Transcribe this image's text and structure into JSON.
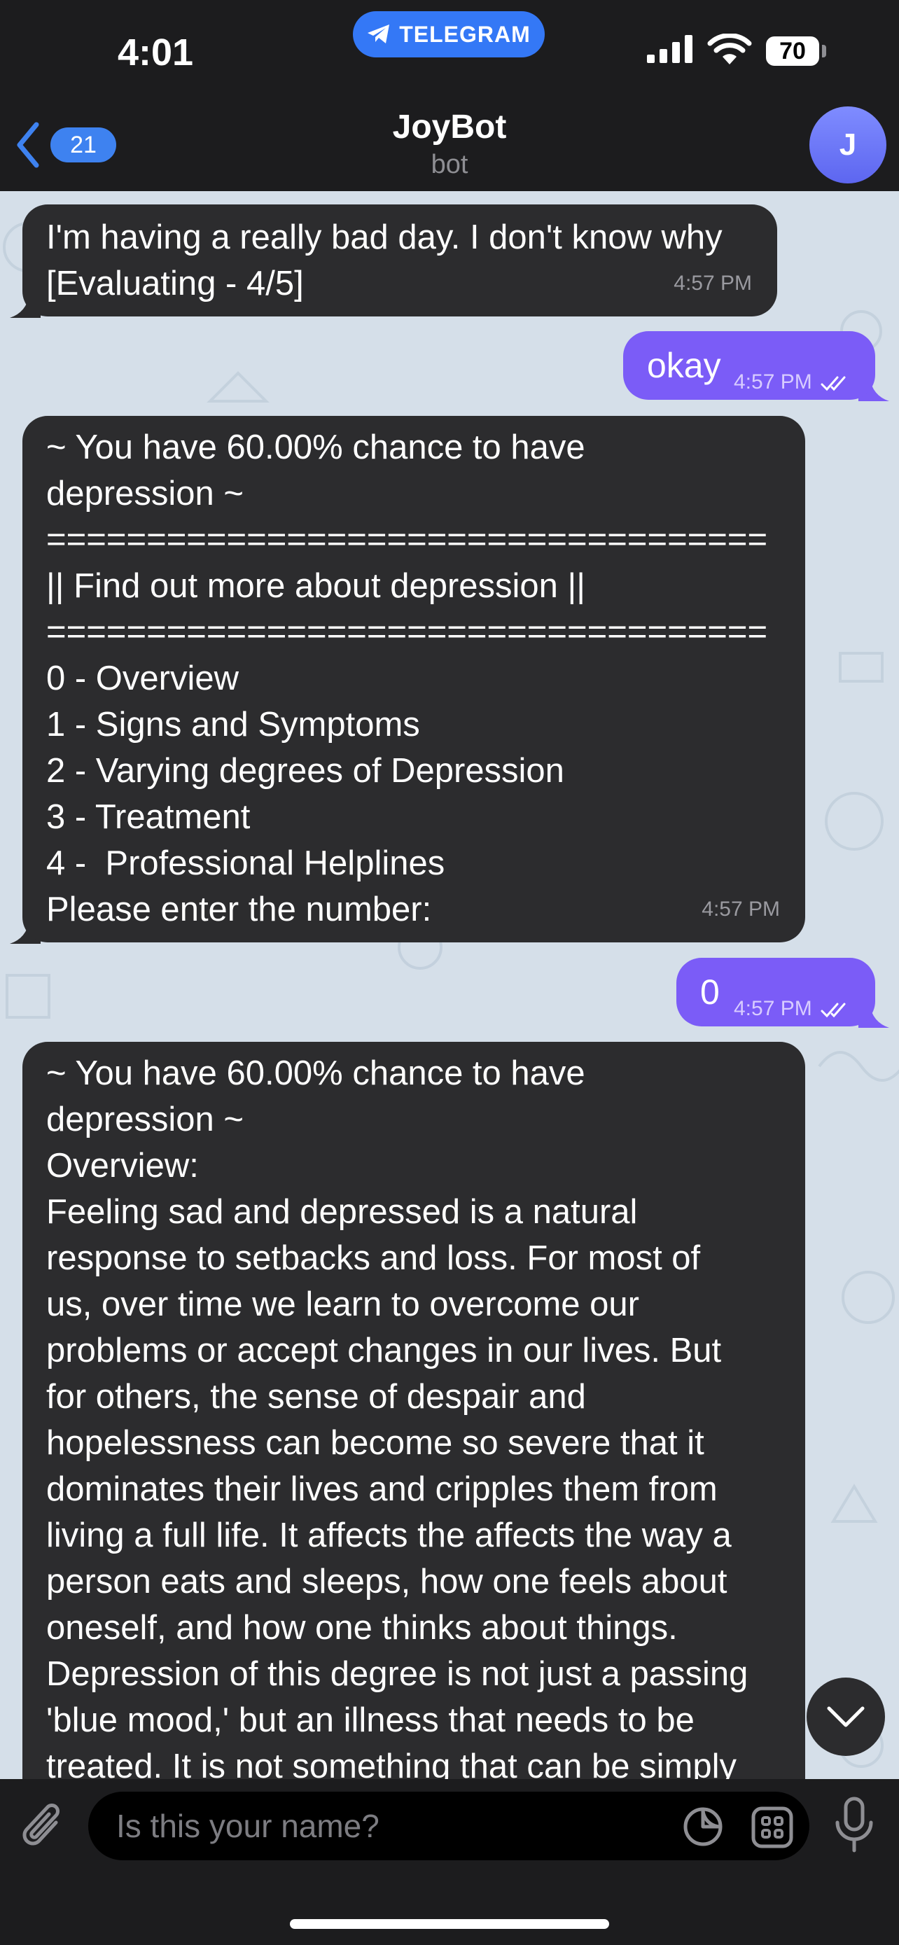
{
  "status_bar": {
    "time": "4:01",
    "app_pill": "TELEGRAM",
    "battery": "70"
  },
  "header": {
    "back_count": "21",
    "title": "JoyBot",
    "subtitle": "bot",
    "avatar_letter": "J"
  },
  "messages": [
    {
      "direction": "incoming",
      "text": "I'm having a really bad day. I don't know why\n[Evaluating - 4/5]",
      "time": "4:57 PM"
    },
    {
      "direction": "outgoing",
      "text": "okay",
      "time": "4:57 PM",
      "read": true
    },
    {
      "direction": "incoming",
      "text": "~ You have 60.00% chance to have\ndepression ~\n====================================\n|| Find out more about depression ||\n====================================\n0 - Overview\n1 - Signs and Symptoms\n2 - Varying degrees of Depression\n3 - Treatment\n4 -  Professional Helplines\nPlease enter the number:",
      "time": "4:57 PM"
    },
    {
      "direction": "outgoing",
      "text": "0",
      "time": "4:57 PM",
      "read": true
    },
    {
      "direction": "incoming",
      "text": "~ You have 60.00% chance to have\ndepression ~\nOverview:\nFeeling sad and depressed is a natural\nresponse to setbacks and loss. For most of\nus, over time we learn to overcome our\nproblems or accept changes in our lives. But\nfor others, the sense of despair and\nhopelessness can become so severe that it\ndominates their lives and cripples them from\nliving a full life. It affects the affects the way a\nperson eats and sleeps, how one feels about\noneself, and how one thinks about things.\nDepression of this degree is not just a passing\n'blue mood,' but an illness that needs to be\ntreated. It is not something that can be simply"
    }
  ],
  "composer": {
    "placeholder": "Is this your name?"
  },
  "colors": {
    "outgoing_bubble": "#7b5cf7",
    "incoming_bubble": "#2c2c2e",
    "accent": "#3478f6",
    "wallpaper": "#d5dfe9"
  },
  "icons": [
    "telegram-plane-icon",
    "signal-icon",
    "wifi-icon",
    "battery-icon",
    "chevron-left-icon",
    "double-check-icon",
    "chevron-down-icon",
    "paperclip-icon",
    "sticker-icon",
    "bot-commands-icon",
    "microphone-icon"
  ]
}
